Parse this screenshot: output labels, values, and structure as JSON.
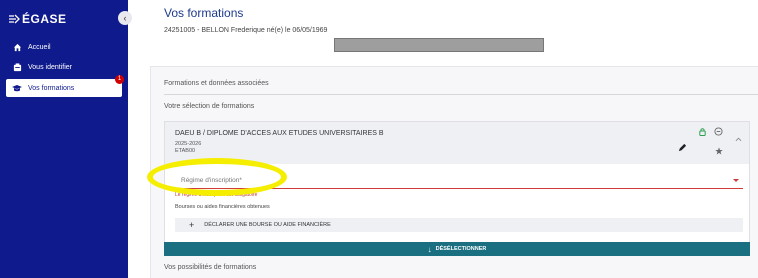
{
  "app": {
    "logo_text": "ÉGASE"
  },
  "sidebar": {
    "items": [
      {
        "label": "Accueil",
        "icon": "home-icon"
      },
      {
        "label": "Vous identifier",
        "icon": "id-card-icon"
      },
      {
        "label": "Vos formations",
        "icon": "graduation-cap-icon",
        "badge": "1"
      }
    ]
  },
  "header": {
    "title": "Vos formations",
    "identity": "24251005 - BELLON Frederique né(e) le 06/05/1969"
  },
  "main": {
    "section_title": "Formations et données associées",
    "selection_title": "Votre sélection de formations",
    "formation": {
      "name": "DAEU B / DIPLOME D'ACCES AUX ETUDES UNIVERSITAIRES B",
      "year": "2025-2026",
      "etab": "ETAB00",
      "regime_label": "Régime d'inscription*",
      "regime_hint": "Le régime d'inscription est obligatoire",
      "bourse_text": "Bourses ou aides financières obtenues",
      "declare_label": "DÉCLARER UNE BOURSE OU AIDE FINANCIÈRE"
    },
    "deselect_label": "DÉSÉLECTIONNER",
    "possibilities_title": "Vos possibilités de formations"
  },
  "colors": {
    "sidebar": "#0f1a8c",
    "accent_teal": "#1a7080",
    "error": "#d23b3b",
    "highlight": "#f5ee00"
  }
}
